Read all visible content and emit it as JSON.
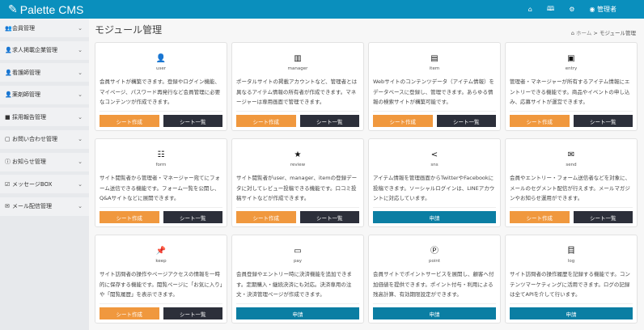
{
  "header": {
    "app_name": "Palette CMS",
    "user_label": "管理者",
    "icons": [
      "home-icon",
      "book-icon",
      "gear-icon",
      "user-circle-icon"
    ]
  },
  "colors": {
    "header": "#0a8fbd",
    "orange": "#f0983e",
    "dark": "#2c2f3a",
    "blue": "#0b7ea3"
  },
  "sidebar": {
    "items": [
      {
        "label": "会員管理",
        "icon": "users-icon"
      },
      {
        "label": "求人掲載企業管理",
        "icon": "user-icon"
      },
      {
        "label": "看護師管理",
        "icon": "user-outline-icon"
      },
      {
        "label": "薬剤師管理",
        "icon": "user-outline-icon"
      },
      {
        "label": "採用報告管理",
        "icon": "folder-icon"
      },
      {
        "label": "お問い合わせ管理",
        "icon": "inbox-icon"
      },
      {
        "label": "お知らせ管理",
        "icon": "info-circle-icon"
      },
      {
        "label": "メッセージBOX",
        "icon": "edit-square-icon"
      },
      {
        "label": "メール配信管理",
        "icon": "mail-icon"
      }
    ]
  },
  "page": {
    "title": "モジュール管理",
    "breadcrumb": {
      "home": "ホーム",
      "separator": ">",
      "current": "モジュール管理"
    }
  },
  "buttons": {
    "create": "シート作成",
    "list": "シート一覧",
    "apply": "申請"
  },
  "modules": [
    {
      "name": "user",
      "icon": "person-icon",
      "glyph": "👤",
      "desc": "会員サイトが構築できます。登録やログイン機能、マイページ、パスワード再発行など会員管理に必要なコンテンツが作成できます。",
      "type": "sheet"
    },
    {
      "name": "manager",
      "icon": "building-icon",
      "glyph": "▥",
      "desc": "ポータルサイトの掲載アカウントなど、管理者とは異なるアイテム情報の所有者が作成できます。マネージャーは専用画面で管理できます。",
      "type": "sheet"
    },
    {
      "name": "item",
      "icon": "document-icon",
      "glyph": "▤",
      "desc": "Webサイトのコンテンツデータ（アイテム情報）をデータベースに登録し、管理できます。あらゆる情報の検索サイトが構築可能です。",
      "type": "sheet"
    },
    {
      "name": "entry",
      "icon": "id-card-icon",
      "glyph": "▣",
      "desc": "管理者・マネージャーが所有するアイテム情報にエントリーできる機能です。商品やイベントの申し込み、応募サイトが運営できます。",
      "type": "sheet"
    },
    {
      "name": "form",
      "icon": "list-icon",
      "glyph": "☷",
      "desc": "サイト閲覧者から管理者・マネージャー宛てにフォーム送信できる機能です。フォーム一覧を公開し、Q&Aサイトなどに展開できます。",
      "type": "sheet"
    },
    {
      "name": "review",
      "icon": "star-icon",
      "glyph": "★",
      "desc": "サイト閲覧者がuser、manager、itemの登録データに対してレビュー投稿できる機能です。口コミ投稿サイトなどが作成できます。",
      "type": "sheet"
    },
    {
      "name": "sns",
      "icon": "share-icon",
      "glyph": "<",
      "desc": "アイテム情報を管理画面からTwitterやFacebookに投稿できます。ソーシャルログインは、LINEアカウントに対応しています。",
      "type": "apply"
    },
    {
      "name": "send",
      "icon": "envelope-icon",
      "glyph": "✉",
      "desc": "会員やエントリー・フォーム送信者などを対象に、メールのセグメント配信が行えます。メールマガジンやお知らせ運用ができます。",
      "type": "sheet"
    },
    {
      "name": "keep",
      "icon": "pin-icon",
      "glyph": "📌",
      "desc": "サイト訪問者の操作やページアクセスの情報を一時的に保存する機能です。閲覧ページに「お気に入り」や「閲覧履歴」を表示できます。",
      "type": "sheet"
    },
    {
      "name": "pay",
      "icon": "credit-card-icon",
      "glyph": "▭",
      "desc": "会員登録やエントリー時に決済機能を追加できます。定期購入・継続決済にも対応。決済専用の注文・決済管理ページが作成できます。",
      "type": "apply"
    },
    {
      "name": "point",
      "icon": "parking-circle-icon",
      "glyph": "Ⓟ",
      "desc": "会員サイトでポイントサービスを展開し、顧客へ付加価値を提供できます。ポイント付与・利用による残高計算、有効期限設定ができます。",
      "type": "apply"
    },
    {
      "name": "log",
      "icon": "receipt-icon",
      "glyph": "目",
      "desc": "サイト訪問者の操作履歴を記録する機能です。コンテンツマーケティングに活用できます。ログの記録は全てAPIを介して行います。",
      "type": "apply"
    }
  ]
}
